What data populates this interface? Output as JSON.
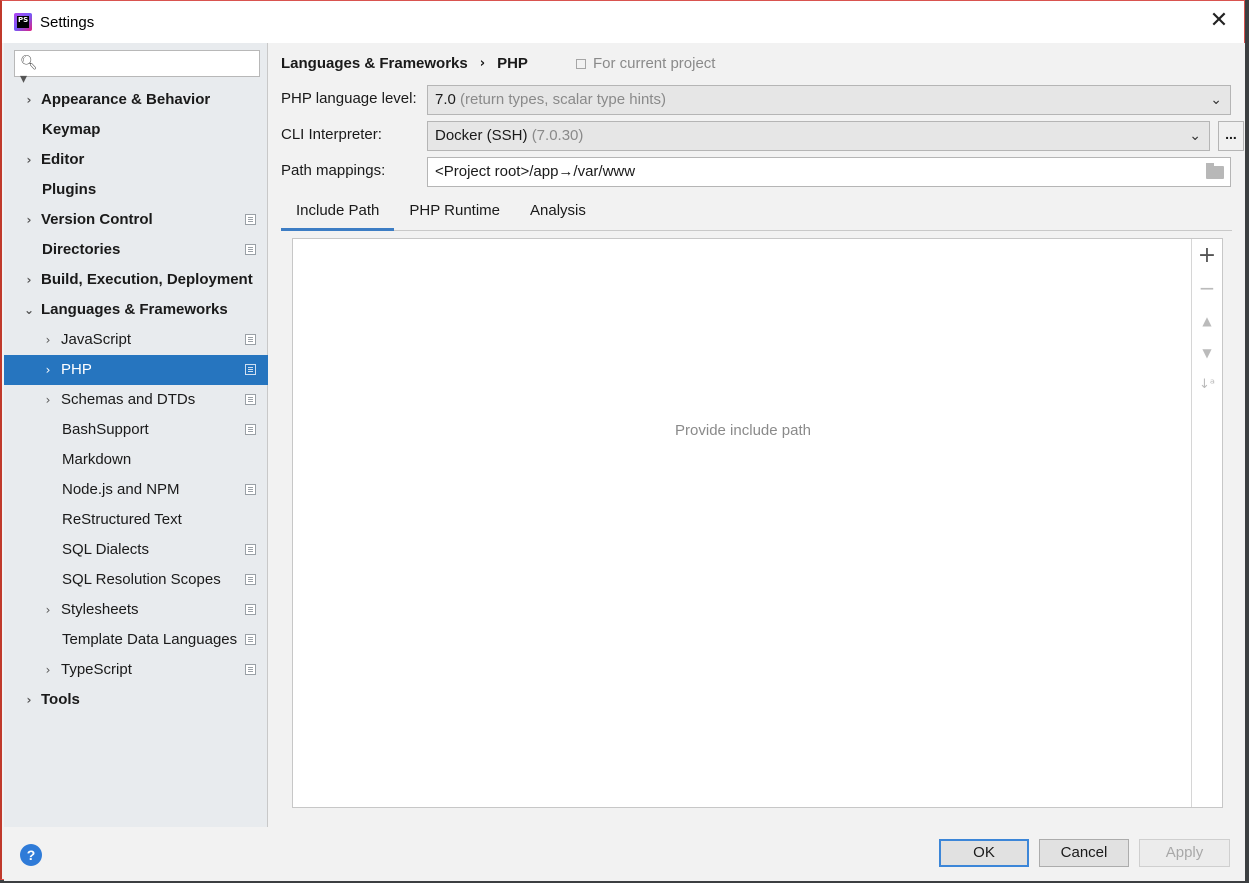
{
  "window": {
    "title": "Settings",
    "app_icon_text": "PS"
  },
  "search": {
    "value": "",
    "placeholder": ""
  },
  "sidebar": {
    "items": [
      {
        "label": "Appearance & Behavior",
        "level": 0,
        "arrow": "›",
        "bold": true,
        "project": false
      },
      {
        "label": "Keymap",
        "level": 0,
        "arrow": "",
        "bold": true,
        "project": false
      },
      {
        "label": "Editor",
        "level": 0,
        "arrow": "›",
        "bold": true,
        "project": false
      },
      {
        "label": "Plugins",
        "level": 0,
        "arrow": "",
        "bold": true,
        "project": false
      },
      {
        "label": "Version Control",
        "level": 0,
        "arrow": "›",
        "bold": true,
        "project": true
      },
      {
        "label": "Directories",
        "level": 0,
        "arrow": "",
        "bold": true,
        "project": true
      },
      {
        "label": "Build, Execution, Deployment",
        "level": 0,
        "arrow": "›",
        "bold": true,
        "project": false
      },
      {
        "label": "Languages & Frameworks",
        "level": 0,
        "arrow": "⌄",
        "bold": true,
        "project": false
      },
      {
        "label": "JavaScript",
        "level": 1,
        "arrow": "›",
        "bold": false,
        "project": true
      },
      {
        "label": "PHP",
        "level": 1,
        "arrow": "›",
        "bold": false,
        "project": true,
        "selected": true
      },
      {
        "label": "Schemas and DTDs",
        "level": 1,
        "arrow": "›",
        "bold": false,
        "project": true
      },
      {
        "label": "BashSupport",
        "level": 1,
        "arrow": "",
        "bold": false,
        "project": true
      },
      {
        "label": "Markdown",
        "level": 1,
        "arrow": "",
        "bold": false,
        "project": false
      },
      {
        "label": "Node.js and NPM",
        "level": 1,
        "arrow": "",
        "bold": false,
        "project": true
      },
      {
        "label": "ReStructured Text",
        "level": 1,
        "arrow": "",
        "bold": false,
        "project": false
      },
      {
        "label": "SQL Dialects",
        "level": 1,
        "arrow": "",
        "bold": false,
        "project": true
      },
      {
        "label": "SQL Resolution Scopes",
        "level": 1,
        "arrow": "",
        "bold": false,
        "project": true
      },
      {
        "label": "Stylesheets",
        "level": 1,
        "arrow": "›",
        "bold": false,
        "project": true
      },
      {
        "label": "Template Data Languages",
        "level": 1,
        "arrow": "",
        "bold": false,
        "project": true
      },
      {
        "label": "TypeScript",
        "level": 1,
        "arrow": "›",
        "bold": false,
        "project": true
      },
      {
        "label": "Tools",
        "level": 0,
        "arrow": "›",
        "bold": true,
        "project": false
      }
    ]
  },
  "breadcrumb": {
    "parent": "Languages & Frameworks",
    "separator": "›",
    "current": "PHP",
    "scope": "For current project"
  },
  "form": {
    "language_level_label": "PHP language level:",
    "language_level_value": "7.0",
    "language_level_hint": "(return types, scalar type hints)",
    "cli_label": "CLI Interpreter:",
    "cli_value": "Docker (SSH)",
    "cli_hint": "(7.0.30)",
    "cli_more": "...",
    "path_label": "Path mappings:",
    "path_value": "<Project root>/app→/var/www"
  },
  "tabs": [
    "Include Path",
    "PHP Runtime",
    "Analysis"
  ],
  "panel": {
    "empty_text": "Provide include path",
    "tools": {
      "add": "+",
      "remove": "−",
      "up": "▲",
      "down": "▼",
      "sort": "↓ᵃ"
    }
  },
  "footer": {
    "help": "?",
    "ok": "OK",
    "cancel": "Cancel",
    "apply": "Apply"
  },
  "colors": {
    "selection": "#2675bf",
    "accent": "#3d7dc4",
    "help": "#2f7bd8"
  }
}
